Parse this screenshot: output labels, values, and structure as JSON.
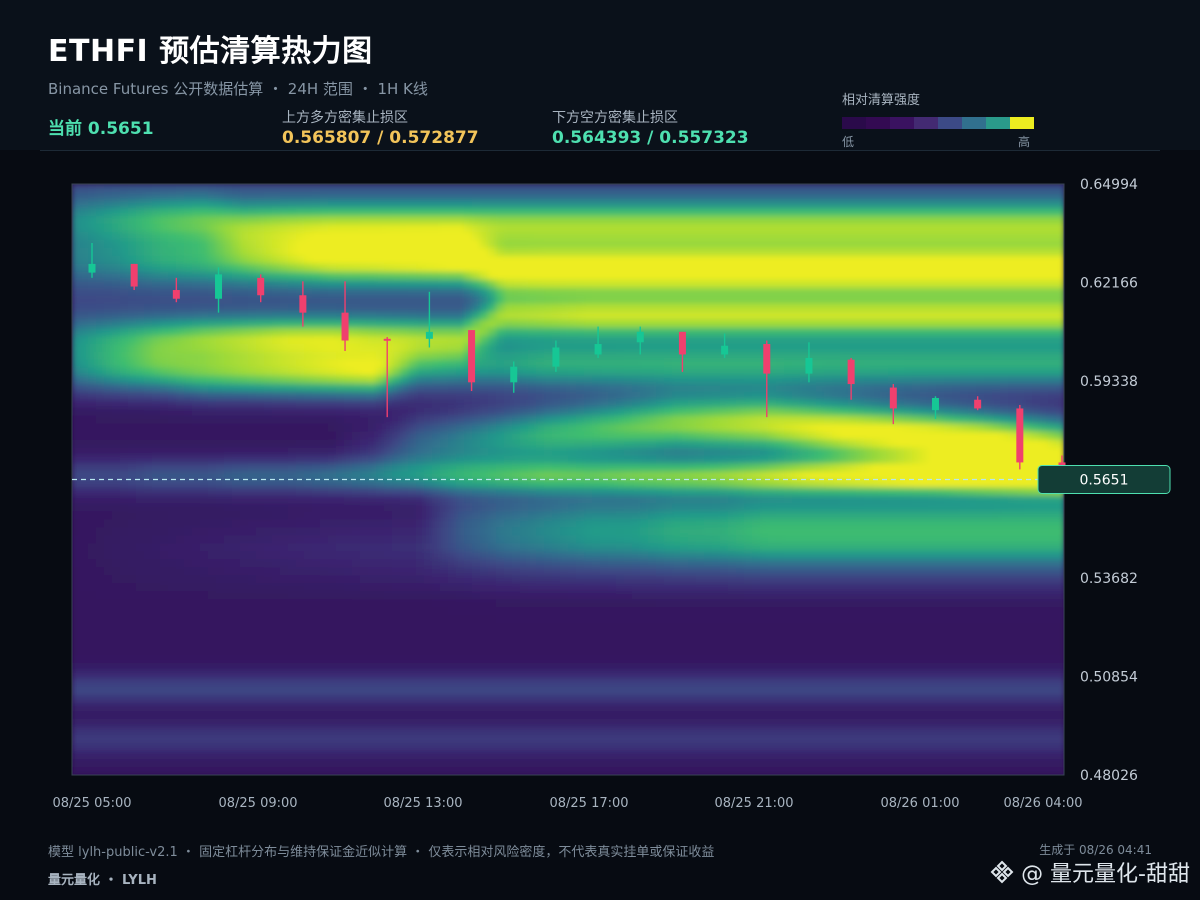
{
  "header": {
    "title": "ETHFI 预估清算热力图",
    "subtitle": "Binance Futures 公开数据估算 ・ 24H 范围 ・ 1H K线",
    "current": "当前 0.5651",
    "upper_zone_label": "上方多方密集止损区",
    "upper_zone_value": "0.565807 / 0.572877",
    "lower_zone_label": "下方空方密集止损区",
    "lower_zone_value": "0.564393 / 0.557323"
  },
  "legend": {
    "title": "相对清算强度",
    "low": "低",
    "high": "高",
    "colors": [
      "#2a0a4a",
      "#330a52",
      "#3a1260",
      "#432a72",
      "#3c4a86",
      "#31708e",
      "#2a9a8a",
      "#eded20"
    ]
  },
  "footer": {
    "note": "模型 lylh-public-v2.1 ・ 固定杠杆分布与维持保证金近似计算 ・ 仅表示相对风险密度，不代表真实挂单或保证收益",
    "brand": "量元量化 ・ LYLH",
    "generated": "生成于 08/26 04:41",
    "watermark": "@ 量元量化-甜甜"
  },
  "chart_data": {
    "type": "heatmap",
    "title": "ETHFI 预估清算热力图",
    "ylim": [
      0.48026,
      0.64994
    ],
    "y_ticks": [
      "0.64994",
      "0.62166",
      "0.59338",
      "0.5651",
      "0.53682",
      "0.50854",
      "0.48026"
    ],
    "x_ticks": [
      "08/25 05:00",
      "08/25 09:00",
      "08/25 13:00",
      "08/25 17:00",
      "08/25 21:00",
      "08/26 01:00",
      "08/26 04:00"
    ],
    "current_price": 0.5651,
    "current_label": "0.5651",
    "colorscale": [
      "#2a0a4a",
      "#3b2470",
      "#3c4a86",
      "#31708e",
      "#219a8a",
      "#3ebd70",
      "#9bd93a",
      "#eded20"
    ],
    "bands": [
      {
        "center": [
          0.6395,
          0.6395,
          0.6395,
          0.6395,
          0.638,
          0.638,
          0.638,
          0.638,
          0.638,
          0.638,
          0.638,
          0.638,
          0.638,
          0.638,
          0.638,
          0.638,
          0.638,
          0.638,
          0.638,
          0.638,
          0.638,
          0.638,
          0.638,
          0.638
        ],
        "width": 0.005,
        "intensity": [
          0.25,
          0.35,
          0.45,
          0.5,
          0.55,
          0.58,
          0.6,
          0.6,
          0.6,
          0.6,
          0.6,
          0.6,
          0.6,
          0.6,
          0.6,
          0.6,
          0.6,
          0.6,
          0.6,
          0.6,
          0.6,
          0.6,
          0.6,
          0.6
        ]
      },
      {
        "center": [
          0.628,
          0.628,
          0.628,
          0.628,
          0.628,
          0.628,
          0.628,
          0.628,
          0.628,
          0.628,
          0.625,
          0.625,
          0.625,
          0.625,
          0.625,
          0.625,
          0.625,
          0.625,
          0.625,
          0.625,
          0.625,
          0.625,
          0.625,
          0.625
        ],
        "width": 0.005,
        "intensity": [
          0.2,
          0.25,
          0.35,
          0.4,
          0.5,
          0.6,
          0.7,
          0.72,
          0.75,
          0.78,
          0.8,
          0.82,
          0.82,
          0.82,
          0.82,
          0.82,
          0.82,
          0.82,
          0.82,
          0.82,
          0.82,
          0.82,
          0.82,
          0.82
        ]
      },
      {
        "center": [
          0.606,
          0.606,
          0.606,
          0.606,
          0.606,
          0.606,
          0.606,
          0.606,
          0.606,
          0.606,
          0.612,
          0.612,
          0.612,
          0.612,
          0.612,
          0.612,
          0.612,
          0.612,
          0.612,
          0.612,
          0.612,
          0.612,
          0.612,
          0.612
        ],
        "width": 0.0042,
        "intensity": [
          0.2,
          0.3,
          0.4,
          0.5,
          0.55,
          0.6,
          0.6,
          0.55,
          0.5,
          0.5,
          0.6,
          0.62,
          0.65,
          0.65,
          0.65,
          0.65,
          0.65,
          0.65,
          0.65,
          0.65,
          0.65,
          0.65,
          0.65,
          0.65
        ]
      },
      {
        "center": [
          0.597,
          0.597,
          0.597,
          0.596,
          0.596,
          0.596,
          0.596,
          0.596,
          0.598,
          0.598,
          0.598,
          0.598,
          0.598,
          0.598,
          0.598,
          0.598,
          0.598,
          0.598,
          0.598,
          0.598,
          0.598,
          0.598,
          0.598,
          0.598
        ],
        "width": 0.005,
        "intensity": [
          0.3,
          0.45,
          0.55,
          0.6,
          0.65,
          0.7,
          0.75,
          0.8,
          0.45,
          0.4,
          0.4,
          0.45,
          0.45,
          0.45,
          0.45,
          0.45,
          0.45,
          0.45,
          0.45,
          0.45,
          0.45,
          0.45,
          0.45,
          0.45
        ]
      },
      {
        "center": [
          0.572,
          0.572,
          0.572,
          0.572,
          0.572,
          0.572,
          0.572,
          0.572,
          0.575,
          0.576,
          0.577,
          0.578,
          0.579,
          0.58,
          0.581,
          0.581,
          0.581,
          0.58,
          0.579,
          0.578,
          0.577,
          0.576,
          0.575,
          0.574
        ],
        "width": 0.006,
        "intensity": [
          0.0,
          0.0,
          0.0,
          0.0,
          0.0,
          0.0,
          0.0,
          0.1,
          0.3,
          0.4,
          0.5,
          0.6,
          0.65,
          0.7,
          0.75,
          0.8,
          0.85,
          0.9,
          0.95,
          0.97,
          1.0,
          1.0,
          0.95,
          0.85
        ]
      },
      {
        "center": [
          0.566,
          0.566,
          0.566,
          0.566,
          0.566,
          0.566,
          0.566,
          0.566,
          0.566,
          0.566,
          0.566,
          0.566,
          0.566,
          0.566,
          0.566,
          0.566,
          0.566,
          0.566,
          0.566,
          0.566,
          0.566,
          0.566,
          0.566,
          0.566
        ],
        "width": 0.0035,
        "intensity": [
          0.2,
          0.2,
          0.25,
          0.25,
          0.3,
          0.3,
          0.35,
          0.35,
          0.4,
          0.45,
          0.5,
          0.55,
          0.55,
          0.6,
          0.62,
          0.65,
          0.7,
          0.75,
          0.78,
          0.8,
          0.8,
          0.85,
          0.88,
          0.9
        ]
      },
      {
        "center": [
          0.556,
          0.556,
          0.556,
          0.556,
          0.556,
          0.556,
          0.556,
          0.556,
          0.554,
          0.553,
          0.552,
          0.552,
          0.552,
          0.552,
          0.552,
          0.552,
          0.552,
          0.552,
          0.552,
          0.552,
          0.552,
          0.552,
          0.552,
          0.552
        ],
        "width": 0.008,
        "intensity": [
          0.0,
          0.0,
          0.0,
          0.0,
          0.0,
          0.0,
          0.0,
          0.0,
          0.0,
          0.2,
          0.3,
          0.35,
          0.4,
          0.4,
          0.45,
          0.45,
          0.5,
          0.5,
          0.5,
          0.5,
          0.5,
          0.5,
          0.5,
          0.5
        ]
      },
      {
        "center": [
          0.505,
          0.505,
          0.505,
          0.505,
          0.505,
          0.505,
          0.505,
          0.505,
          0.505,
          0.505,
          0.505,
          0.505,
          0.505,
          0.505,
          0.505,
          0.505,
          0.505,
          0.505,
          0.505,
          0.505,
          0.505,
          0.505,
          0.505,
          0.505
        ],
        "width": 0.003,
        "intensity": [
          0.2,
          0.2,
          0.2,
          0.2,
          0.2,
          0.2,
          0.2,
          0.2,
          0.2,
          0.2,
          0.2,
          0.2,
          0.2,
          0.2,
          0.2,
          0.2,
          0.2,
          0.2,
          0.2,
          0.2,
          0.2,
          0.2,
          0.2,
          0.2
        ]
      },
      {
        "center": [
          0.4905,
          0.4905,
          0.4905,
          0.4905,
          0.4905,
          0.4905,
          0.4905,
          0.4905,
          0.4905,
          0.4905,
          0.4905,
          0.4905,
          0.4905,
          0.4905,
          0.4905,
          0.4905,
          0.4905,
          0.4905,
          0.4905,
          0.4905,
          0.4905,
          0.4905,
          0.4905,
          0.4905
        ],
        "width": 0.003,
        "intensity": [
          0.15,
          0.15,
          0.15,
          0.15,
          0.15,
          0.15,
          0.15,
          0.15,
          0.15,
          0.15,
          0.15,
          0.15,
          0.15,
          0.15,
          0.15,
          0.15,
          0.15,
          0.15,
          0.15,
          0.15,
          0.15,
          0.15,
          0.15,
          0.15
        ]
      }
    ],
    "candles": [
      {
        "o": 0.6245,
        "h": 0.633,
        "l": 0.623,
        "c": 0.627
      },
      {
        "o": 0.627,
        "h": 0.627,
        "l": 0.6195,
        "c": 0.6205
      },
      {
        "o": 0.6195,
        "h": 0.623,
        "l": 0.616,
        "c": 0.617
      },
      {
        "o": 0.617,
        "h": 0.626,
        "l": 0.613,
        "c": 0.624
      },
      {
        "o": 0.623,
        "h": 0.624,
        "l": 0.616,
        "c": 0.618
      },
      {
        "o": 0.618,
        "h": 0.622,
        "l": 0.609,
        "c": 0.613
      },
      {
        "o": 0.613,
        "h": 0.622,
        "l": 0.602,
        "c": 0.605
      },
      {
        "o": 0.6055,
        "h": 0.606,
        "l": 0.583,
        "c": 0.605
      },
      {
        "o": 0.6055,
        "h": 0.619,
        "l": 0.603,
        "c": 0.6075
      },
      {
        "o": 0.608,
        "h": 0.608,
        "l": 0.5905,
        "c": 0.593
      },
      {
        "o": 0.593,
        "h": 0.599,
        "l": 0.59,
        "c": 0.5975
      },
      {
        "o": 0.5975,
        "h": 0.605,
        "l": 0.596,
        "c": 0.603
      },
      {
        "o": 0.601,
        "h": 0.609,
        "l": 0.6,
        "c": 0.604
      },
      {
        "o": 0.6045,
        "h": 0.609,
        "l": 0.601,
        "c": 0.6075
      },
      {
        "o": 0.6075,
        "h": 0.6075,
        "l": 0.596,
        "c": 0.601
      },
      {
        "o": 0.601,
        "h": 0.607,
        "l": 0.6,
        "c": 0.6035
      },
      {
        "o": 0.604,
        "h": 0.605,
        "l": 0.583,
        "c": 0.5955
      },
      {
        "o": 0.5955,
        "h": 0.6045,
        "l": 0.593,
        "c": 0.6
      },
      {
        "o": 0.5995,
        "h": 0.6,
        "l": 0.588,
        "c": 0.5925
      },
      {
        "o": 0.5915,
        "h": 0.5925,
        "l": 0.581,
        "c": 0.5855
      },
      {
        "o": 0.585,
        "h": 0.589,
        "l": 0.5825,
        "c": 0.5885
      },
      {
        "o": 0.588,
        "h": 0.589,
        "l": 0.585,
        "c": 0.5855
      },
      {
        "o": 0.5855,
        "h": 0.5865,
        "l": 0.568,
        "c": 0.57
      },
      {
        "o": 0.57,
        "h": 0.572,
        "l": 0.5655,
        "c": 0.568
      }
    ]
  }
}
